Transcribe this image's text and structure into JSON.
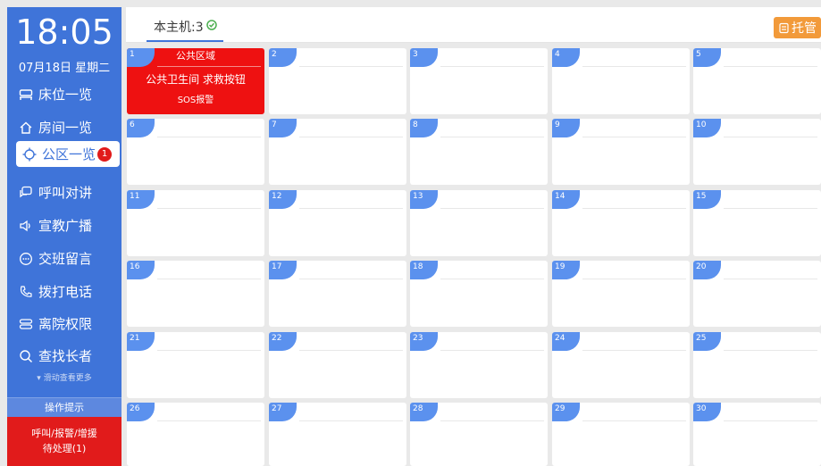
{
  "clock": {
    "time": "18:05",
    "date": "07月18日 星期二"
  },
  "nav": [
    {
      "id": "bed",
      "label": "床位一览",
      "icon": "bed-icon"
    },
    {
      "id": "room",
      "label": "房间一览",
      "icon": "home-icon"
    },
    {
      "id": "public",
      "label": "公区一览",
      "icon": "target-icon",
      "badge": "1",
      "active": true
    },
    {
      "id": "call",
      "label": "呼叫对讲",
      "icon": "chat-icon"
    },
    {
      "id": "broadcast",
      "label": "宣教广播",
      "icon": "speaker-icon"
    },
    {
      "id": "handover",
      "label": "交班留言",
      "icon": "message-icon"
    },
    {
      "id": "phone",
      "label": "拨打电话",
      "icon": "phone-icon"
    },
    {
      "id": "discharge",
      "label": "离院权限",
      "icon": "exit-icon"
    },
    {
      "id": "search",
      "label": "查找长者",
      "icon": "search-icon"
    }
  ],
  "more_hint": "滑动查看更多",
  "tips": {
    "title": "操作提示",
    "alert_line1": "呼叫/报警/增援",
    "alert_line2": "待处理(1)"
  },
  "topbar": {
    "tab_label": "本主机:3",
    "trust_label": "托管"
  },
  "sos_cell": {
    "area": "公共区域",
    "location": "公共卫生间 求救按钮",
    "type": "SOS报警"
  },
  "cells": [
    "1",
    "2",
    "3",
    "4",
    "5",
    "6",
    "7",
    "8",
    "9",
    "10",
    "11",
    "12",
    "13",
    "14",
    "15",
    "16",
    "17",
    "18",
    "19",
    "20",
    "21",
    "22",
    "23",
    "24",
    "25",
    "26",
    "27",
    "28",
    "29",
    "30"
  ],
  "colors": {
    "sidebar": "#3f74d9",
    "alert": "#e11b1b",
    "sos": "#ee1111",
    "trust": "#f29a3a",
    "num_tag": "#5b91ee"
  }
}
